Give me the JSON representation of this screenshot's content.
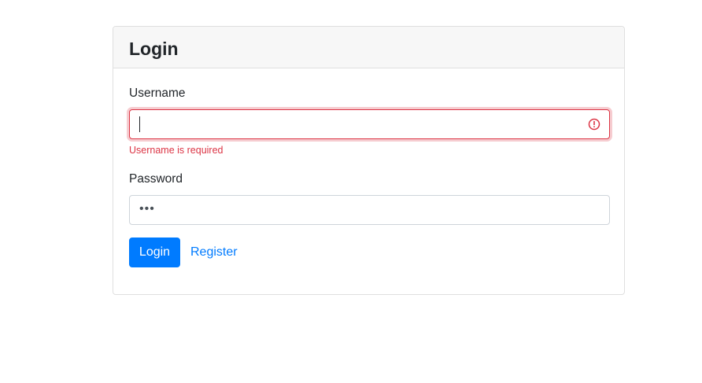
{
  "login_card": {
    "title": "Login",
    "username": {
      "label": "Username",
      "value": "",
      "error": "Username is required",
      "error_color": "#dc3545"
    },
    "password": {
      "label": "Password",
      "masked_value": "•••"
    },
    "actions": {
      "login_label": "Login",
      "register_label": "Register",
      "primary_color": "#007bff"
    }
  }
}
